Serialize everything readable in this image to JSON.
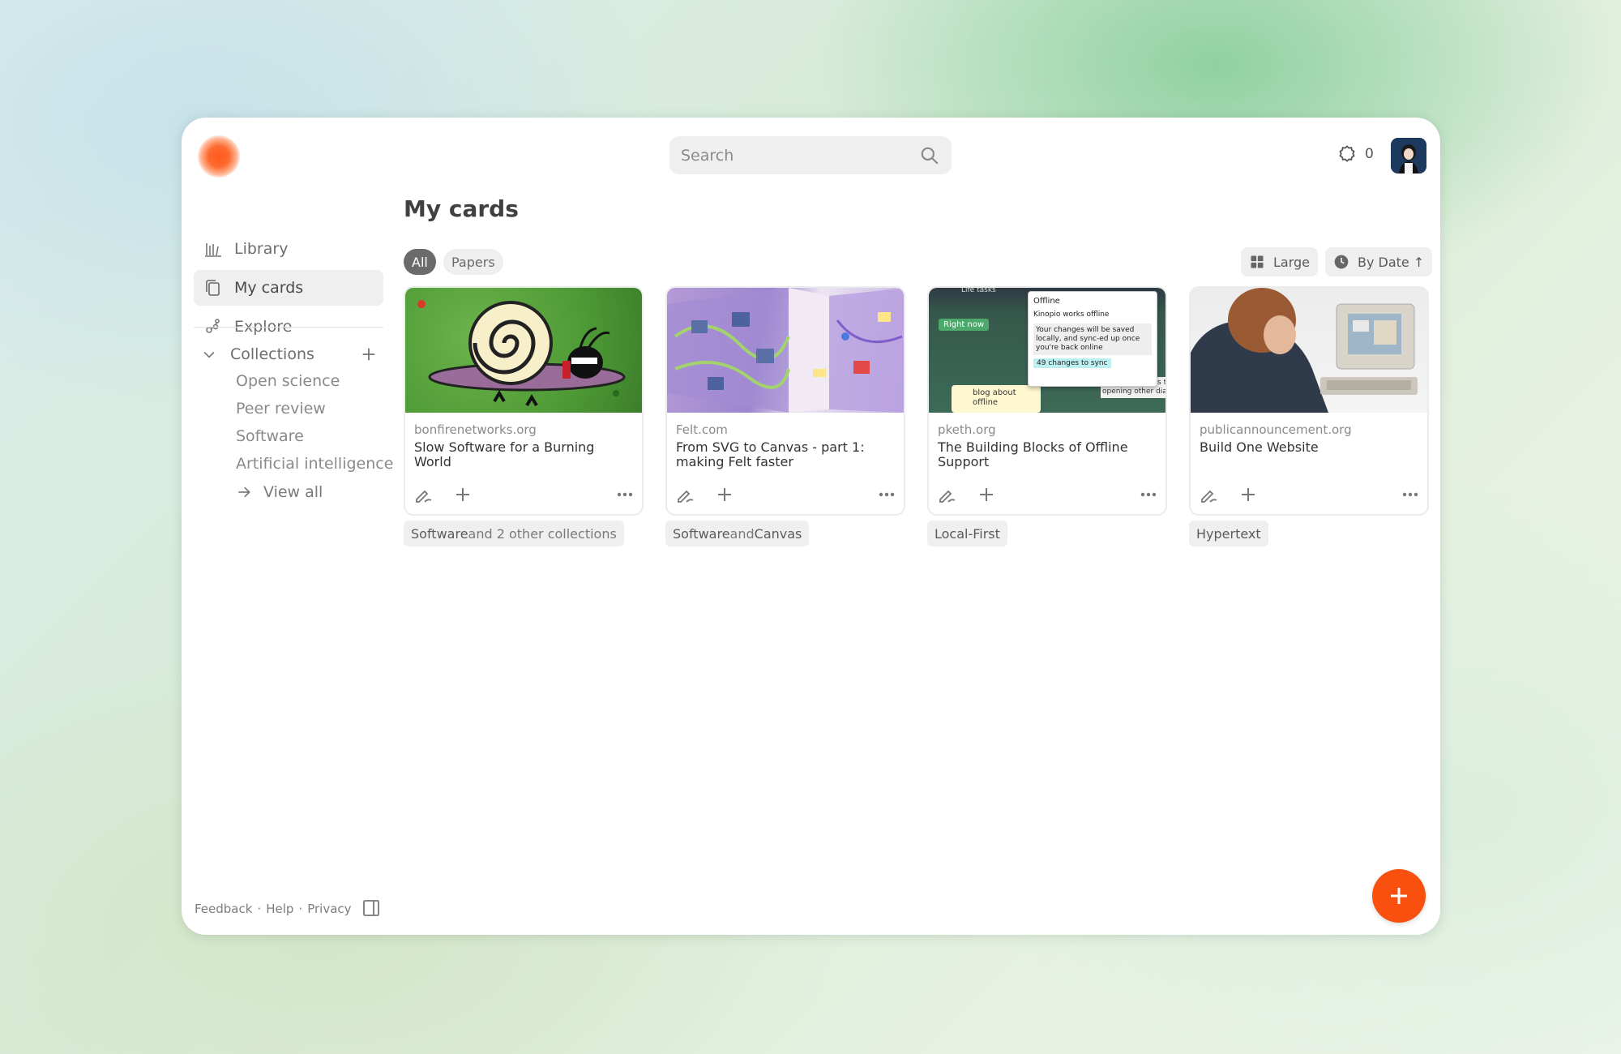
{
  "header": {
    "search_placeholder": "Search",
    "notification_count": "0"
  },
  "sidebar": {
    "nav": [
      {
        "label": "Library",
        "icon": "library-icon"
      },
      {
        "label": "My cards",
        "icon": "cards-icon",
        "active": true
      },
      {
        "label": "Explore",
        "icon": "explore-icon"
      }
    ],
    "collections_label": "Collections",
    "collections": [
      "Open science",
      "Peer review",
      "Software",
      "Artificial intelligence"
    ],
    "view_all": "View all",
    "footer": {
      "feedback": "Feedback",
      "help": "Help",
      "privacy": "Privacy",
      "sep": "·"
    }
  },
  "main": {
    "title": "My cards",
    "filters": [
      "All",
      "Papers"
    ],
    "view_size": "Large",
    "sort": "By Date ↑",
    "cards": [
      {
        "domain": "bonfirenetworks.org",
        "title": "Slow Software for a Burning World",
        "tag_main": "Software",
        "tag_rest": " and 2 other collections"
      },
      {
        "domain": "Felt.com",
        "title": "From SVG to Canvas - part 1: making Felt faster",
        "tag_main": "Software",
        "tag_mid": " and ",
        "tag_second": "Canvas"
      },
      {
        "domain": "pketh.org",
        "title": "The Building Blocks of Offline Support",
        "tag_main": "Local-First"
      },
      {
        "domain": "publicannouncement.org",
        "title": "Build One Website",
        "tag_main": "Hypertext"
      }
    ],
    "thumb3": {
      "popup_title": "Offline",
      "popup_subtitle": "Kinopio works offline",
      "popup_body": "Your changes will be saved locally, and sync-ed up once you're back online",
      "popup_badge": "49 changes to sync",
      "right_now": "Right now",
      "blog": "blog about offline",
      "life_tasks": "Life tasks",
      "side_text": "results filter has to opening other dia"
    }
  },
  "colors": {
    "accent": "#f9500f",
    "chip_active": "#6b6b6b"
  }
}
